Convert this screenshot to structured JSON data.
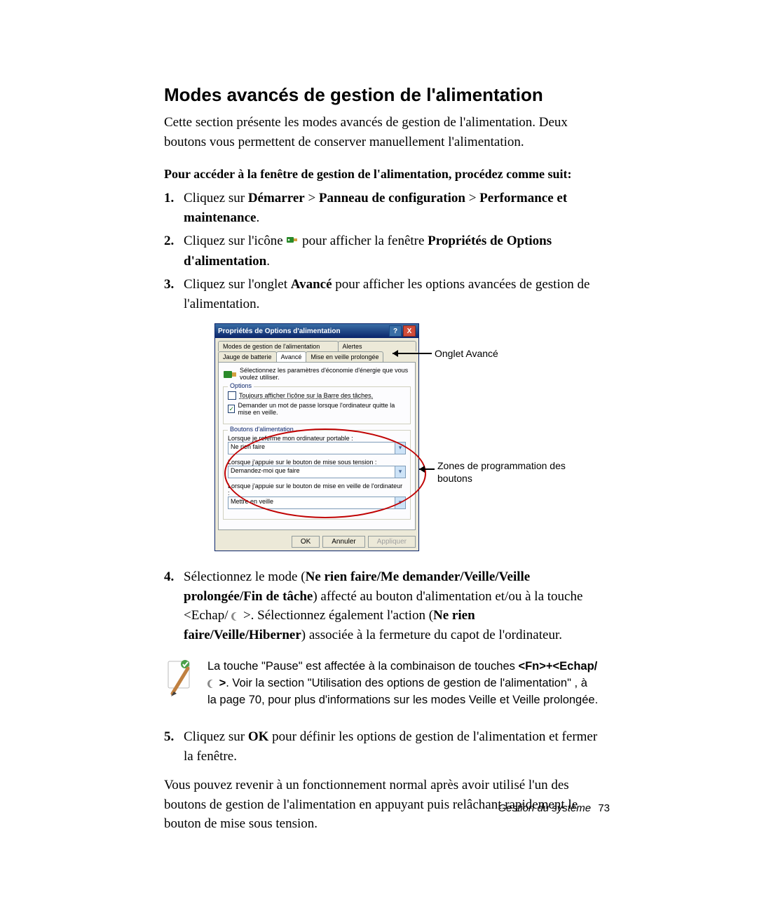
{
  "heading": "Modes avancés de gestion de l'alimentation",
  "intro": "Cette section présente les modes avancés de gestion de l'alimentation. Deux boutons vous permettent de conserver manuellement l'alimentation.",
  "lead": "Pour accéder à la fenêtre de gestion de l'alimentation, procédez comme suit:",
  "steps": {
    "s1_pre": "Cliquez sur ",
    "s1_b1": "Démarrer",
    "s1_gt1": " > ",
    "s1_b2": "Panneau de configuration",
    "s1_gt2": " > ",
    "s1_b3": "Performance et maintenance",
    "s1_end": ".",
    "s2_pre": "Cliquez sur l'icône ",
    "s2_mid": " pour afficher la fenêtre ",
    "s2_b1": "Propriétés de Options d'alimentation",
    "s2_end": ".",
    "s3_pre": "Cliquez sur l'onglet ",
    "s3_b1": "Avancé",
    "s3_end": " pour afficher les options avancées de gestion de l'alimentation.",
    "s4_pre": "Sélectionnez le mode (",
    "s4_b1": "Ne rien faire/Me demander/Veille/Veille prolongée/Fin de tâche",
    "s4_mid1": ") affecté au bouton d'alimentation et/ou à la touche <Echap/ ",
    "s4_mid2": " >. Sélectionnez également l'action (",
    "s4_b2": "Ne rien faire/Veille/Hiberner",
    "s4_end": ") associée à la fermeture du capot de l'ordinateur.",
    "s5_pre": "Cliquez sur ",
    "s5_b1": "OK",
    "s5_end": " pour définir les options de gestion de l'alimentation et fermer la fenêtre."
  },
  "nums": {
    "n1": "1.",
    "n2": "2.",
    "n3": "3.",
    "n4": "4.",
    "n5": "5."
  },
  "closing": "Vous pouvez revenir à un fonctionnement normal après avoir utilisé l'un des boutons de gestion de l'alimentation en appuyant puis relâchant rapidement le bouton de mise sous tension.",
  "note_pre": "La touche \"Pause\" est affectée à la combinaison de touches ",
  "note_b1": "<Fn>+<Echap/ ",
  "note_mid": " >",
  "note_end": ". Voir la section \"Utilisation des options de gestion de l'alimentation\" , à la page 70, pour plus d'informations sur les modes Veille et Veille prolongée.",
  "dialog": {
    "title": "Propriétés de Options d'alimentation",
    "help": "?",
    "close": "X",
    "tabs_row1": {
      "a": "Modes de gestion de l'alimentation",
      "b": "Alertes"
    },
    "tabs_row2": {
      "a": "Jauge de batterie",
      "b": "Avancé",
      "c": "Mise en veille prolongée"
    },
    "desc": "Sélectionnez les paramètres d'économie d'énergie que vous voulez utiliser.",
    "grp_options": "Options",
    "chk1": "Toujours afficher l'icône sur la Barre des tâches.",
    "chk2": "Demander un mot de passe lorsque l'ordinateur quitte la mise en veille.",
    "grp_buttons": "Boutons d'alimentation",
    "lbl1": "Lorsque je referme mon ordinateur portable :",
    "val1": "Ne rien faire",
    "lbl2": "Lorsque j'appuie sur le bouton de mise sous tension :",
    "val2": "Demandez-moi que faire",
    "lbl3": "Lorsque j'appuie sur le bouton de mise en veille de l'ordinateur :",
    "val3": "Mettre en veille",
    "ok": "OK",
    "cancel": "Annuler",
    "apply": "Appliquer"
  },
  "callouts": {
    "c1": "Onglet Avancé",
    "c2": "Zones de programmation des boutons"
  },
  "footer": {
    "label": "Gestion du système",
    "page": "73"
  }
}
